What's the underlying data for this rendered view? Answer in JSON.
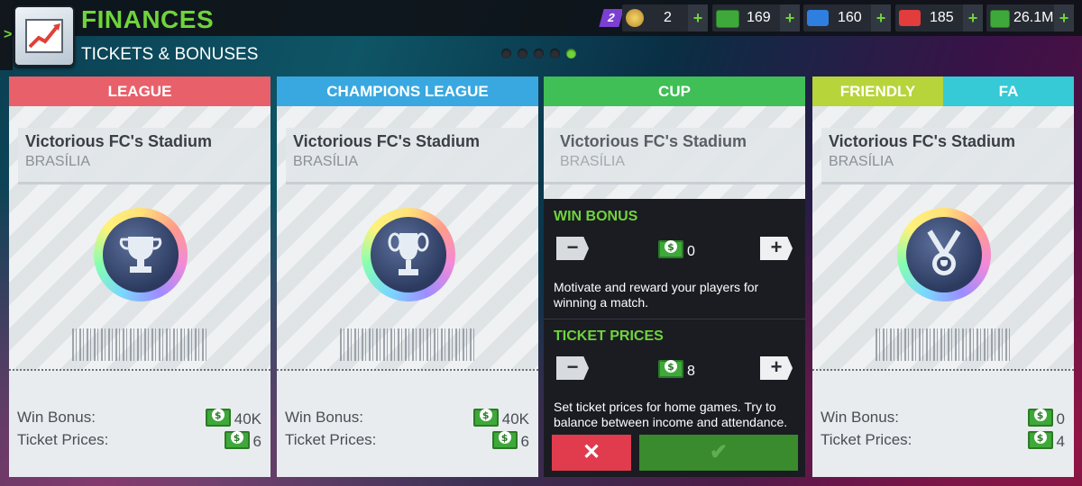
{
  "header": {
    "title": "FINANCES",
    "subtitle": "TICKETS & BONUSES",
    "page_dots": 5,
    "active_dot": 5
  },
  "resources": {
    "badge": "2",
    "coins": "2",
    "cash_notes": "169",
    "energy": "160",
    "medical": "185",
    "money": "26.1M",
    "plus": "+"
  },
  "cards": [
    {
      "header": "LEAGUE",
      "header_color": "#e8606a",
      "stadium": "Victorious FC's Stadium",
      "city": "BRASÍLIA",
      "win_bonus_label": "Win Bonus:",
      "win_bonus": "40K",
      "ticket_label": "Ticket Prices:",
      "ticket_price": "6"
    },
    {
      "header": "CHAMPIONS LEAGUE",
      "header_color": "#3aa8e0",
      "stadium": "Victorious FC's Stadium",
      "city": "BRASÍLIA",
      "win_bonus_label": "Win Bonus:",
      "win_bonus": "40K",
      "ticket_label": "Ticket Prices:",
      "ticket_price": "6"
    },
    {
      "header": "CUP",
      "header_color": "#3fbf55",
      "stadium": "Victorious FC's Stadium",
      "city": "BRASÍLIA"
    },
    {
      "header_left": "FRIENDLY",
      "header_right": "FA",
      "header_left_color": "#b7d43a",
      "header_right_color": "#36c9d6",
      "stadium": "Victorious FC's Stadium",
      "city": "BRASÍLIA",
      "win_bonus_label": "Win Bonus:",
      "win_bonus": "0",
      "ticket_label": "Ticket Prices:",
      "ticket_price": "4"
    }
  ],
  "cup_panel": {
    "win_bonus_title": "WIN BONUS",
    "win_bonus_value": "0",
    "win_bonus_desc": "Motivate and reward your players for winning a match.",
    "ticket_title": "TICKET PRICES",
    "ticket_value": "8",
    "ticket_desc": "Set ticket prices for home games. Try to balance between income and attendance.",
    "minus": "−",
    "plus": "+",
    "cancel": "✕",
    "confirm": "✔"
  }
}
